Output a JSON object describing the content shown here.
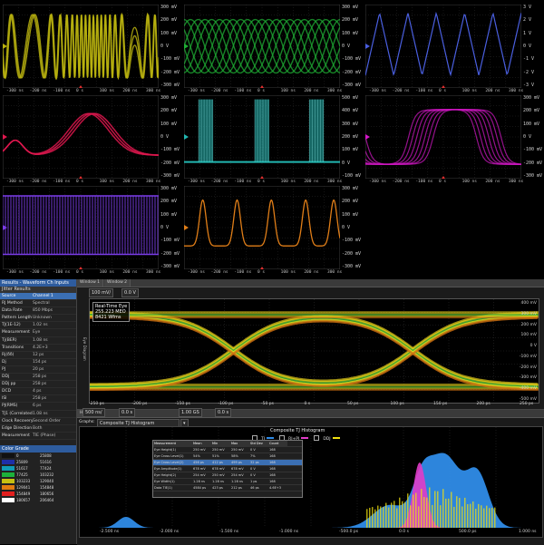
{
  "tiles": [
    {
      "id": "t1",
      "y_labels": [
        "300 mV",
        "200 mV",
        "100 mV",
        "0 V",
        "-100 mV",
        "-200 mV",
        "-300 mV"
      ],
      "x_labels": [
        "-300 ns",
        "-200 ns",
        "-100 ns",
        "0 s",
        "100 ns",
        "200 ns",
        "300 ns"
      ],
      "color": "#b9b10f"
    },
    {
      "id": "t2",
      "y_labels": [
        "300 mV",
        "200 mV",
        "100 mV",
        "0 V",
        "-100 mV",
        "-200 mV",
        "-300 mV"
      ],
      "x_labels": [
        "-300 ns",
        "-200 ns",
        "-100 ns",
        "0 s",
        "100 ns",
        "200 ns",
        "300 ns"
      ],
      "color": "#1fae34"
    },
    {
      "id": "t3",
      "y_labels": [
        "3 V",
        "2 V",
        "1 V",
        "0 V",
        "-1 V",
        "-2 V",
        "-3 V"
      ],
      "x_labels": [
        "-300 ns",
        "-200 ns",
        "-100 ns",
        "0 s",
        "100 ns",
        "200 ns",
        "300 ns"
      ],
      "color": "#4a5fe0"
    },
    {
      "id": "t4",
      "y_labels": [
        "300 mV",
        "200 mV",
        "100 mV",
        "0 V",
        "-100 mV",
        "-200 mV",
        "-300 mV"
      ],
      "x_labels": [
        "-300 ns",
        "-200 ns",
        "-100 ns",
        "0 s",
        "100 ns",
        "200 ns",
        "300 ns"
      ],
      "color": "#e0184f"
    },
    {
      "id": "t5",
      "y_labels": [
        "500 mV",
        "400 mV",
        "300 mV",
        "200 mV",
        "100 mV",
        "0 V",
        "-100 mV"
      ],
      "x_labels": [
        "-300 ns",
        "-200 ns",
        "-100 ns",
        "0 s",
        "100 ns",
        "200 ns",
        "300 ns"
      ],
      "color": "#22b6b0"
    },
    {
      "id": "t6",
      "y_labels": [
        "300 mV",
        "200 mV",
        "100 mV",
        "0 V",
        "-100 mV",
        "-200 mV",
        "-300 mV"
      ],
      "x_labels": [
        "-300 ns",
        "-200 ns",
        "-100 ns",
        "0 s",
        "100 ns",
        "200 ns",
        "300 ns"
      ],
      "color": "#d418c8"
    },
    {
      "id": "t7",
      "y_labels": [
        "300 mV",
        "200 mV",
        "100 mV",
        "0 V",
        "-100 mV",
        "-200 mV",
        "-300 mV"
      ],
      "x_labels": [
        "-300 ns",
        "-200 ns",
        "-100 ns",
        "0 s",
        "100 ns",
        "200 ns",
        "300 ns"
      ],
      "color": "#7b3ce8"
    },
    {
      "id": "t8",
      "y_labels": [
        "300 mV",
        "200 mV",
        "100 mV",
        "0 V",
        "-100 mV",
        "-200 mV",
        "-300 mV"
      ],
      "x_labels": [
        "-300 ns",
        "-200 ns",
        "-100 ns",
        "0 s",
        "100 ns",
        "200 ns",
        "300 ns"
      ],
      "color": "#e07e18"
    }
  ],
  "left_panel": {
    "title": "Results - Waveform Ch Inputs",
    "subtitle": "Jitter Results",
    "rows": [
      {
        "k": "Source",
        "v": "Channel 1"
      },
      {
        "k": "RJ Method",
        "v": "Spectral"
      },
      {
        "k": "Data Rate",
        "v": "850 Mbps"
      },
      {
        "k": "Pattern Length",
        "v": "Unknown"
      },
      {
        "k": "TJ(1E-12)",
        "v": "1.02 ns"
      },
      {
        "k": "Measurement",
        "v": "Eye"
      },
      {
        "k": "Tj(BER)",
        "v": "1.08 ns"
      },
      {
        "k": "Transitions",
        "v": "4.2E+3"
      },
      {
        "k": "Rj(δδ)",
        "v": "12 ps"
      },
      {
        "k": "Dj",
        "v": "154 ps"
      },
      {
        "k": "PJ",
        "v": "20 ps"
      },
      {
        "k": "DDj",
        "v": "258 ps"
      },
      {
        "k": "DDj pp",
        "v": "258 ps"
      },
      {
        "k": "DCD",
        "v": "4 ps"
      },
      {
        "k": "ISI",
        "v": "258 ps"
      },
      {
        "k": "PJ(RMS)",
        "v": "6 ps"
      },
      {
        "k": "TJ1 (Correlated)",
        "v": "1.08 ns"
      },
      {
        "k": "Clock Recovery",
        "v": "Second Order"
      },
      {
        "k": "Edge Direction",
        "v": "Both"
      },
      {
        "k": "Measurement",
        "v": "TIE (Phase)"
      }
    ],
    "selected_row": 0
  },
  "color_panel": {
    "title": "Color Grade",
    "rows": [
      {
        "a": "0",
        "b": "25808",
        "color": "#111111"
      },
      {
        "a": "25809",
        "b": "51616",
        "color": "#1e2ea8"
      },
      {
        "a": "51617",
        "b": "77424",
        "color": "#0f9bb6"
      },
      {
        "a": "77425",
        "b": "103232",
        "color": "#1cb23a"
      },
      {
        "a": "103233",
        "b": "129040",
        "color": "#c6c012"
      },
      {
        "a": "129041",
        "b": "154848",
        "color": "#e07a10"
      },
      {
        "a": "154849",
        "b": "180656",
        "color": "#e21f1f"
      },
      {
        "a": "180657",
        "b": "206464",
        "color": "#ffffff"
      }
    ]
  },
  "eye": {
    "tab1": "Window 1",
    "tab2": "Window 2",
    "ctrl1": "100 mV/",
    "ctrl2": "0.0 V",
    "side_label": "Eye Diagram",
    "readout_title": "Real-Time Eye",
    "readout_1": "255.223 MEO",
    "readout_2": "8421 Wfms",
    "y_labels": [
      "400 mV",
      "300 mV",
      "200 mV",
      "100 mV",
      "0 V",
      "-100 mV",
      "-200 mV",
      "-300 mV",
      "-400 mV",
      "-500 mV"
    ],
    "x_labels": [
      "-250 ps",
      "-200 ps",
      "-150 ps",
      "-100 ps",
      "-50 ps",
      "0 s",
      "50 ps",
      "100 ps",
      "150 ps",
      "200 ps",
      "250 ps"
    ],
    "bottom_ctrl": [
      "500 ns/",
      "0.0 s",
      "1.00 GS",
      "0.0 s"
    ]
  },
  "hist": {
    "tab": "Histo",
    "dropdown": "Composite TJ Histogram",
    "title": "Composite TJ Histogram",
    "legend": [
      {
        "name": "TJ",
        "color": "#2f8ce8"
      },
      {
        "name": "RJ+PJ",
        "color": "#e03cc8"
      },
      {
        "name": "DDJ",
        "color": "#f0e010"
      }
    ],
    "table_head": [
      "Measurement",
      "Mean",
      "Min",
      "Max",
      "Std Dev",
      "Count"
    ],
    "table_rows": [
      [
        "Eye Height(1)",
        "250 mV",
        "250 mV",
        "250 mV",
        "0 V",
        "168"
      ],
      [
        "Eye Cross Level(1)",
        "54%",
        "51%",
        "58%",
        "7%",
        "168"
      ],
      [
        "Eye Cross Level(2)",
        "456 ps",
        "412 ps",
        "499 ps",
        "32 ps",
        "168"
      ],
      [
        "Eye Amplitude(1)",
        "678 mV",
        "678 mV",
        "678 mV",
        "0 V",
        "168"
      ],
      [
        "Eye Height(2)",
        "254 mV",
        "250 mV",
        "254 mV",
        "0 V",
        "168"
      ],
      [
        "Eye Width(1)",
        "1.28 ns",
        "1.28 ns",
        "1.28 ns",
        "1 ps",
        "168"
      ],
      [
        "Data TIE(1)",
        "4584 ps",
        "423 ps",
        "212 ps",
        "46 ps",
        "4.6E+3"
      ]
    ],
    "x_labels": [
      "-2.500 ns",
      "-2.000 ns",
      "-1.500 ns",
      "-1.000 ns",
      "-500.0 ps",
      "0.0 s",
      "500.0 ps",
      "1.000 ns"
    ]
  }
}
